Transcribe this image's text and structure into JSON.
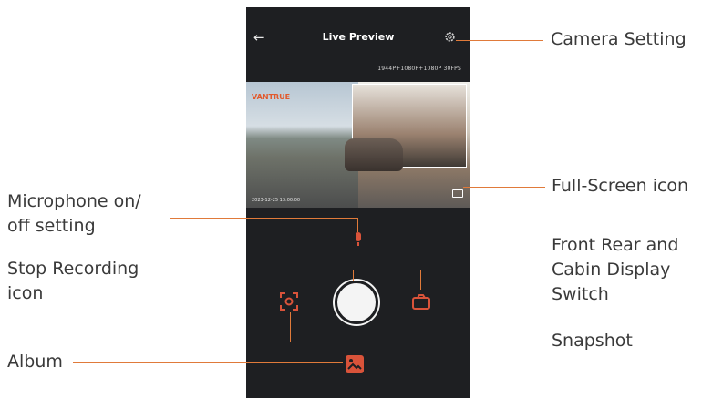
{
  "header": {
    "title": "Live Preview",
    "back_icon": "arrow-left-icon",
    "settings_icon": "gear-icon"
  },
  "preview": {
    "resolution": "1944P+1080P+1080P 30FPS",
    "logo_text": "VANTRUE",
    "caption": "2023-12-25 13:00:00"
  },
  "controls": {
    "mic_icon": "microphone-icon",
    "record_button": "stop-recording-button",
    "snapshot_icon": "snapshot-icon",
    "switch_icon": "camera-switch-icon",
    "album_icon": "album-icon"
  },
  "callouts": {
    "camera_setting": "Camera Setting",
    "full_screen": "Full-Screen icon",
    "mic_line1": "Microphone on/",
    "mic_line2": "off setting",
    "stop_line1": "Stop Recording",
    "stop_line2": "icon",
    "switch_line1": "Front Rear and",
    "switch_line2": "Cabin Display",
    "switch_line3": "Switch",
    "snapshot": "Snapshot",
    "album": "Album"
  },
  "colors": {
    "accent": "#e07a3a",
    "phone_bg": "#1e1f22",
    "icon_red": "#d9533a"
  }
}
